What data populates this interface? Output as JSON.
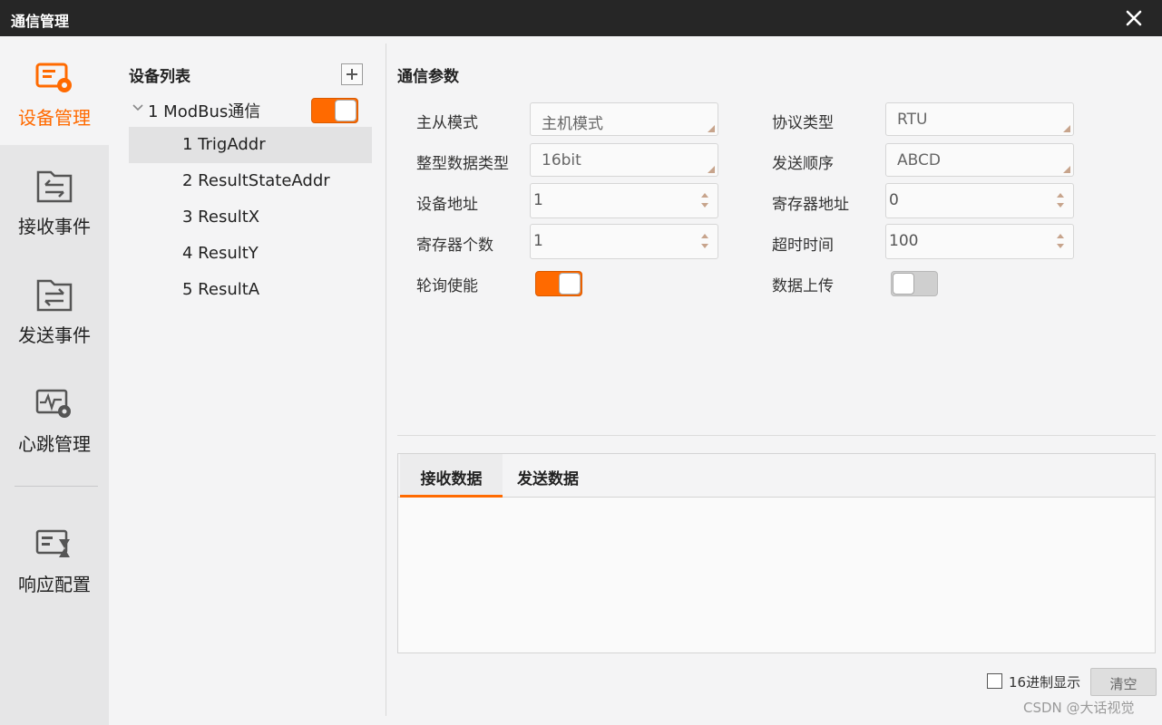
{
  "window": {
    "title": "通信管理"
  },
  "nav": {
    "items": [
      {
        "label": "设备管理",
        "icon": "device-management-icon",
        "active": true
      },
      {
        "label": "接收事件",
        "icon": "receive-event-icon"
      },
      {
        "label": "发送事件",
        "icon": "send-event-icon"
      },
      {
        "label": "心跳管理",
        "icon": "heartbeat-icon"
      },
      {
        "label": "响应配置",
        "icon": "response-config-icon"
      }
    ]
  },
  "device_list": {
    "header": "设备列表",
    "root": {
      "name": "1 ModBus通信",
      "enabled": true
    },
    "children": [
      "1 TrigAddr",
      "2 ResultStateAddr",
      "3 ResultX",
      "4 ResultY",
      "5 ResultA"
    ],
    "selected_index": 0
  },
  "params": {
    "title": "通信参数",
    "master_slave_label": "主从模式",
    "master_slave_value": "主机模式",
    "protocol_label": "协议类型",
    "protocol_value": "RTU",
    "int_type_label": "整型数据类型",
    "int_type_value": "16bit",
    "send_order_label": "发送顺序",
    "send_order_value": "ABCD",
    "device_addr_label": "设备地址",
    "device_addr_value": "1",
    "register_addr_label": "寄存器地址",
    "register_addr_value": "0",
    "register_count_label": "寄存器个数",
    "register_count_value": "1",
    "timeout_label": "超时时间",
    "timeout_value": "100",
    "polling_label": "轮询使能",
    "polling_enabled": true,
    "upload_label": "数据上传",
    "upload_enabled": false
  },
  "tabs": [
    "接收数据",
    "发送数据"
  ],
  "footer": {
    "hex_label": "16进制显示",
    "hex_checked": false,
    "clear_label": "清空"
  },
  "watermark": "CSDN @大话视觉",
  "colors": {
    "accent": "#ff6a00",
    "titlebar": "#262626"
  }
}
